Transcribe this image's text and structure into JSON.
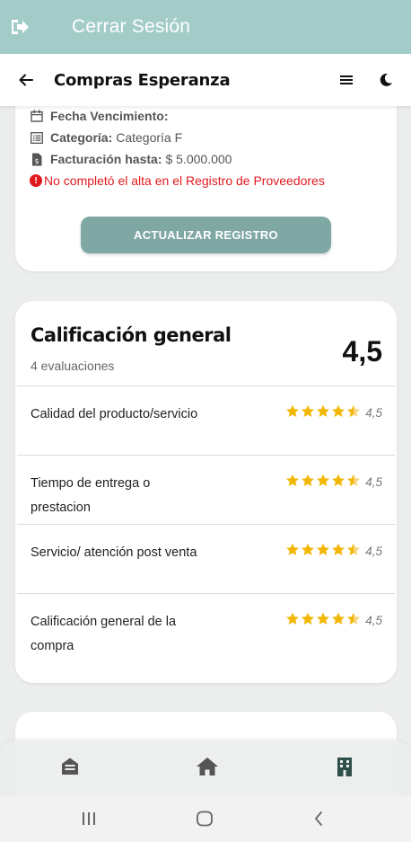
{
  "topbar": {
    "logout_label": "Cerrar Sesión",
    "icon": "logout-icon"
  },
  "header": {
    "title": "Compras Esperanza",
    "back_icon": "arrow-left-icon",
    "menu_icon": "hamburger-icon",
    "theme_icon": "moon-icon"
  },
  "supplier_info": {
    "expiry_label": "Fecha Vencimiento:",
    "expiry_value": "",
    "category_label": "Categoría:",
    "category_value": "Categoría F",
    "billing_label": "Facturación hasta:",
    "billing_value": "$ 5.000.000",
    "warning_text": "No completó el alta en el Registro de Proveedores",
    "update_button": "ACTUALIZAR REGISTRO"
  },
  "rating": {
    "title": "Calificación general",
    "subtitle": "4 evaluaciones",
    "score": "4,5",
    "items": [
      {
        "label": "Calidad del producto/servicio",
        "value": "4,5",
        "stars": 4.5
      },
      {
        "label": "Tiempo de entrega o prestacion",
        "value": "4,5",
        "stars": 4.5
      },
      {
        "label": "Servicio/ atención post venta",
        "value": "4,5",
        "stars": 4.5
      },
      {
        "label": "Calificación general de la compra",
        "value": "4,5",
        "stars": 4.5
      }
    ]
  },
  "colors": {
    "topbar": "#a3ccc8",
    "accent": "#7fa7a4",
    "star": "#f2b705",
    "warning": "#e0191f"
  },
  "bottom_nav": [
    "inbox-icon",
    "home-icon",
    "building-icon"
  ],
  "system_nav": [
    "recent-apps-icon",
    "home-circle-icon",
    "back-chevron-icon"
  ]
}
